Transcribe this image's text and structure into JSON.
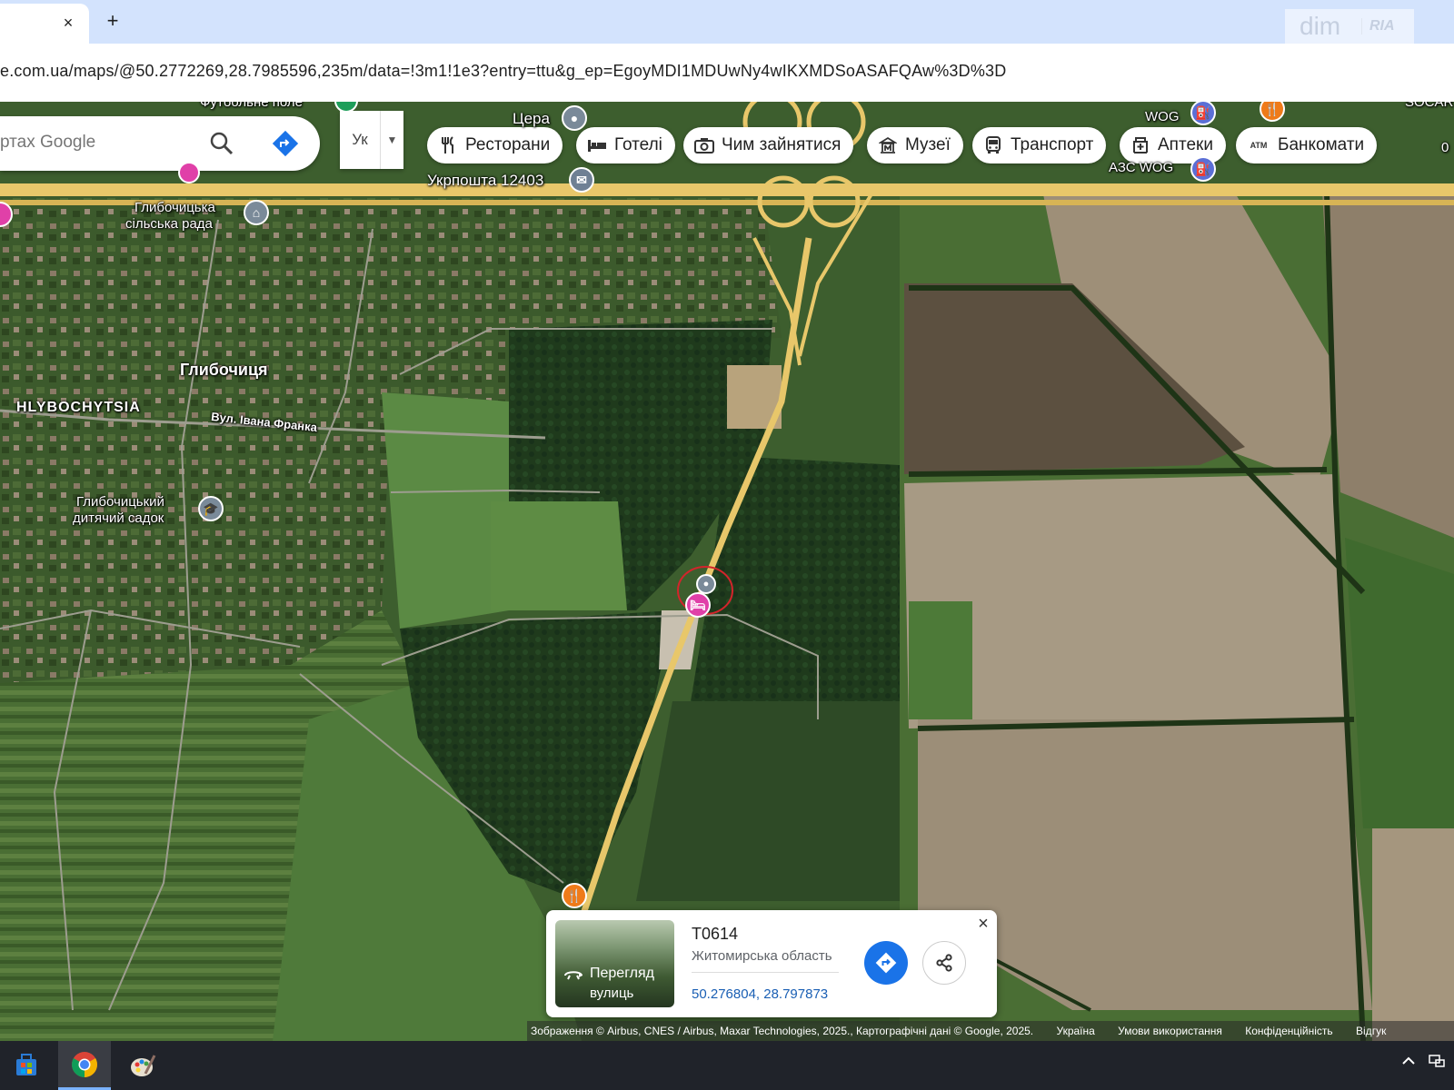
{
  "browser": {
    "tab_close": "×",
    "new_tab": "+",
    "url": "e.com.ua/maps/@50.2772269,28.7985596,235m/data=!3m1!1e3?entry=ttu&g_ep=EgoyMDI1MDUwNy4wIKXMDSoASAFQAw%3D%3D"
  },
  "watermark": {
    "dim": "dim",
    "ria": "RIA"
  },
  "search": {
    "placeholder": "ртах Google"
  },
  "layers": {
    "label": "Ук",
    "caret": "▼"
  },
  "chips": [
    {
      "label": "Ресторани",
      "icon": "fork-knife-icon"
    },
    {
      "label": "Готелі",
      "icon": "bed-icon"
    },
    {
      "label": "Чим зайнятися",
      "icon": "camera-icon"
    },
    {
      "label": "Музеї",
      "icon": "museum-icon"
    },
    {
      "label": "Транспорт",
      "icon": "bus-icon"
    },
    {
      "label": "Аптеки",
      "icon": "pharmacy-icon"
    },
    {
      "label": "Банкомати",
      "icon": "atm-icon",
      "badge": "ATM"
    }
  ],
  "map_labels": {
    "football": "Футбольне поле",
    "tsera": "Цера",
    "wog": "WOG",
    "socar": "SOCAR",
    "zero": "0",
    "ukrposhta": "Укрпошта 12403",
    "azs_wog": "АЗС WOG",
    "council_line1": "Глибочицька",
    "council_line2": "сільська рада",
    "village": "Глибочиця",
    "village_latin": "HLYBOCHYTSIA",
    "street": "Вул. Івана Франка",
    "kindergarten_line1": "Глибочицький",
    "kindergarten_line2": "дитячий садок"
  },
  "card": {
    "title": "Т0614",
    "region": "Житомирська область",
    "coords": "50.276804, 28.797873",
    "street_view_line1": "Перегляд",
    "street_view_line2": "вулиць",
    "close": "×"
  },
  "attribution": {
    "imagery": "Зображення © Airbus, CNES / Airbus, Maxar Technologies, 2025., Картографічні дані © Google, 2025.",
    "country": "Україна",
    "terms": "Умови використання",
    "privacy": "Конфіденційність",
    "feedback": "Відгук"
  },
  "colors": {
    "chip_bg": "#ffffff",
    "direction_blue": "#1a73e8",
    "restaurant_pin": "#ef7b1a",
    "hotel_pin": "#e040a8",
    "road": "#e8c76a",
    "taskbar": "#20232a"
  }
}
